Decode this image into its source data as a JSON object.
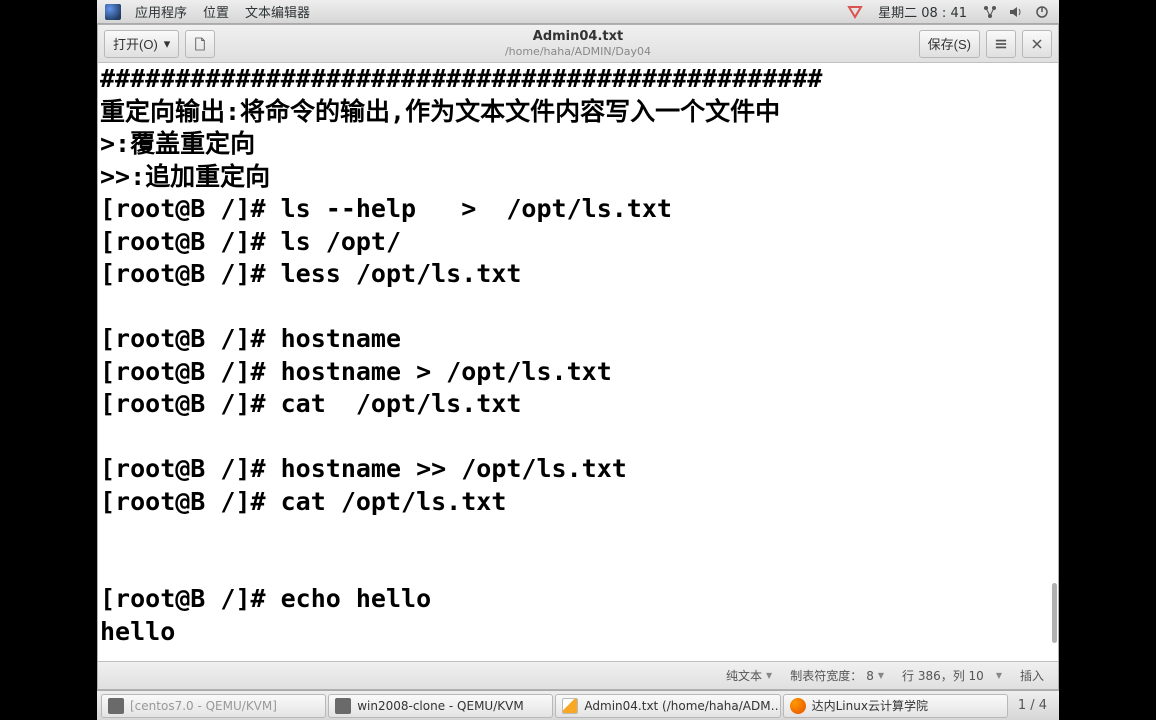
{
  "top_panel": {
    "menu": [
      "应用程序",
      "位置",
      "文本编辑器"
    ],
    "datetime": "星期二 08 : 41"
  },
  "toolbar": {
    "open_label": "打开(O)",
    "save_label": "保存(S)",
    "title": "Admin04.txt",
    "subtitle": "/home/haha/ADMIN/Day04"
  },
  "content": {
    "lines": [
      "################################################",
      "重定向输出:将命令的输出,作为文本文件内容写入一个文件中",
      ">:覆盖重定向",
      ">>:追加重定向",
      "[root@B /]# ls --help   >  /opt/ls.txt",
      "[root@B /]# ls /opt/",
      "[root@B /]# less /opt/ls.txt",
      "",
      "[root@B /]# hostname",
      "[root@B /]# hostname > /opt/ls.txt",
      "[root@B /]# cat  /opt/ls.txt",
      "",
      "[root@B /]# hostname >> /opt/ls.txt",
      "[root@B /]# cat /opt/ls.txt",
      "",
      "",
      "[root@B /]# echo hello",
      "hello"
    ]
  },
  "status_bar": {
    "encoding": "纯文本",
    "tab_width_label": "制表符宽度：",
    "tab_width_value": "8",
    "position": "行 386，列 10",
    "mode": "插入"
  },
  "page_indicator": "1 / 4",
  "taskbar": {
    "items": [
      {
        "label": "[centos7.0 - QEMU/KVM]",
        "icon": "vm",
        "active": false
      },
      {
        "label": "win2008-clone - QEMU/KVM",
        "icon": "vm",
        "active": true
      },
      {
        "label": "Admin04.txt (/home/haha/ADM…",
        "icon": "editor",
        "active": true
      },
      {
        "label": "达内Linux云计算学院",
        "icon": "firefox",
        "active": true
      }
    ]
  }
}
